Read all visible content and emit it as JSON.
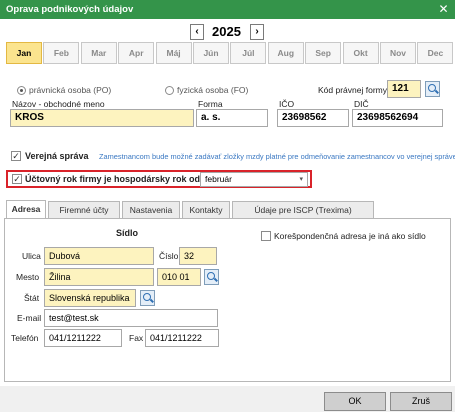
{
  "window": {
    "title": "Oprava podnikových údajov",
    "close": "✕"
  },
  "year_nav": {
    "prev": "‹",
    "year": "2025",
    "next": "›"
  },
  "months": [
    "Jan",
    "Feb",
    "Mar",
    "Apr",
    "Máj",
    "Jún",
    "Júl",
    "Aug",
    "Sep",
    "Okt",
    "Nov",
    "Dec"
  ],
  "entity": {
    "legal": "právnická osoba (PO)",
    "natural": "fyzická osoba (FO)",
    "selected": "legal",
    "legal_form_code_label": "Kód právnej formy",
    "legal_form_code": "121"
  },
  "company": {
    "name_label": "Názov - obchodné meno",
    "name": "KROS",
    "form_label": "Forma",
    "form": "a. s.",
    "ico_label": "IČO",
    "ico": "23698562",
    "dic_label": "DIČ",
    "dic": "23698562694"
  },
  "public_admin": {
    "label": "Verejná správa",
    "checked": true,
    "note": "Zamestnancom bude možné zadávať zložky mzdy platné pre odmeňovanie zamestnancov vo verejnej správe"
  },
  "fiscal_year": {
    "label": "Účtovný rok firmy je hospodársky rok od",
    "checked": true,
    "value": "február"
  },
  "tabs": [
    "Adresa",
    "Firemné účty",
    "Nastavenia",
    "Kontakty",
    "Údaje pre ISCP (Trexima)"
  ],
  "address": {
    "section_title": "Sídlo",
    "street_label": "Ulica",
    "street": "Dubová",
    "number_label": "Číslo",
    "number": "32",
    "city_label": "Mesto",
    "city": "Žilina",
    "zip": "010 01",
    "state_label": "Štát",
    "state": "Slovenská republika",
    "email_label": "E-mail",
    "email": "test@test.sk",
    "phone_label": "Telefón",
    "phone": "041/1211222",
    "fax_label": "Fax",
    "fax": "041/1211222",
    "correspondence_label": "Korešpondenčná adresa je iná ako sídlo"
  },
  "buttons": {
    "ok": "OK",
    "cancel": "Zruš"
  },
  "colors": {
    "titlebar": "#34944a",
    "highlight": "#fbe48e",
    "field_yellow": "#fdf3bf",
    "outline_red": "#d9232a"
  }
}
